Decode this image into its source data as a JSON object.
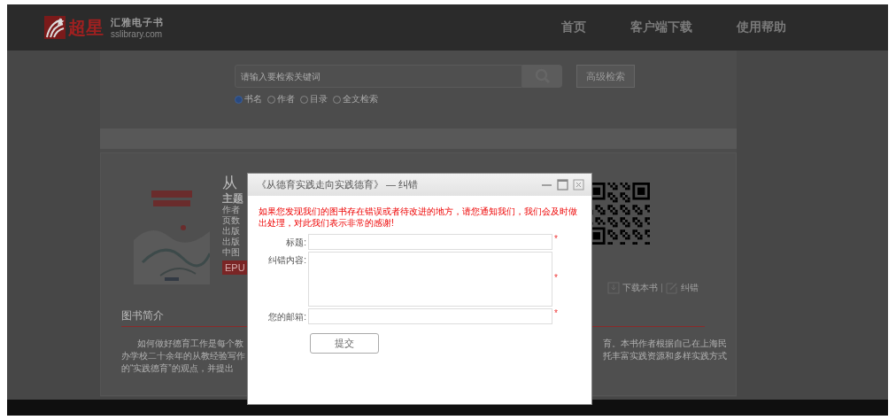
{
  "header": {
    "logo": {
      "mark": "超星",
      "brand": "汇雅电子书",
      "domain": "sslibrary.com"
    },
    "nav": [
      {
        "label": "首页"
      },
      {
        "label": "客户端下载"
      },
      {
        "label": "使用帮助"
      }
    ]
  },
  "search": {
    "placeholder": "请输入要检索关键词",
    "advanced": "高级检索",
    "options": [
      {
        "label": "书名",
        "selected": true
      },
      {
        "label": "作者",
        "selected": false
      },
      {
        "label": "目录",
        "selected": false
      },
      {
        "label": "全文检索",
        "selected": false
      }
    ]
  },
  "book": {
    "title": "从",
    "fields": [
      "主题",
      "作者",
      "页数",
      "出版",
      "出版",
      "中图"
    ],
    "format": "EPU",
    "actions": [
      {
        "kind": "download",
        "label": "下载本书"
      },
      {
        "kind": "edit",
        "label": "纠错"
      }
    ],
    "intro_heading": "图书简介",
    "intro_lines": [
      {
        "left": "如何做好德育工作是每个教",
        "right": "育。本书作者根据自己在上海民"
      },
      {
        "left": "办学校二十余年的从教经验写作",
        "right": "托丰富实践资源和多样实践方式"
      },
      {
        "left": "的“实践德育”的观点，并提出"
      }
    ]
  },
  "dialog": {
    "title": "《从德育实践走向实践德育》 — 纠错",
    "notice": "如果您发现我们的图书存在错误或者待改进的地方，请您通知我们，我们会及时做出处理，对此我们表示非常的感谢!",
    "fields": [
      {
        "label": "标题:",
        "kind": "input",
        "mark": "*"
      },
      {
        "label": "纠错内容:",
        "kind": "textarea",
        "mark": "*"
      },
      {
        "label": "您的邮箱:",
        "kind": "input",
        "mark": "*"
      }
    ],
    "submit": "提交"
  }
}
